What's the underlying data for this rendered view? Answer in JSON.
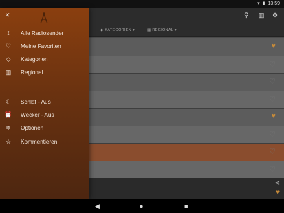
{
  "status": {
    "time": "13:59"
  },
  "tabs": {
    "categories": "KATEGORIEN",
    "regional": "REGIONAL"
  },
  "drawer": {
    "items": [
      {
        "label": "Alle Radiosender"
      },
      {
        "label": "Meine Favoriten"
      },
      {
        "label": "Kategorien"
      },
      {
        "label": "Regional"
      },
      {
        "label": "Schlaf - Aus"
      },
      {
        "label": "Wecker - Aus"
      },
      {
        "label": "Optionen"
      },
      {
        "label": "Kommentieren"
      }
    ]
  },
  "list": {
    "favorites": [
      true,
      false,
      false,
      false,
      true,
      false,
      false,
      false
    ]
  },
  "colors": {
    "drawer_top": "#8a3f0f",
    "accent": "#c58a3a",
    "active_row": "#8a4d2e"
  }
}
